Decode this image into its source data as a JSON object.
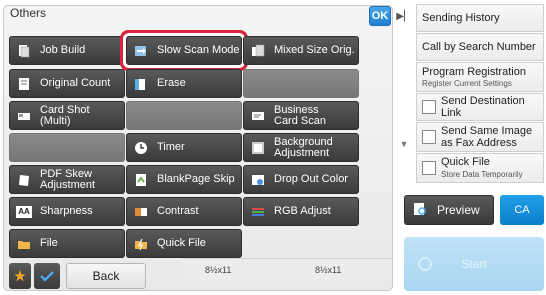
{
  "panel": {
    "title": "Others",
    "ok_label": "OK"
  },
  "grid": [
    {
      "label": "Job Build",
      "icon": "job-build-icon",
      "enabled": true
    },
    {
      "label": "Slow Scan Mode",
      "icon": "slow-scan-icon",
      "enabled": true,
      "highlighted": true
    },
    {
      "label": "Mixed Size Orig.",
      "icon": "mixed-size-icon",
      "enabled": true
    },
    {
      "label": "Original Count",
      "icon": "original-count-icon",
      "enabled": true
    },
    {
      "label": "Erase",
      "icon": "erase-icon",
      "enabled": true
    },
    {
      "label": "",
      "icon": "",
      "enabled": false
    },
    {
      "label": "Card Shot (Multi)",
      "icon": "card-shot-icon",
      "enabled": true
    },
    {
      "label": "",
      "icon": "",
      "enabled": false
    },
    {
      "label": "Business Card Scan",
      "icon": "business-card-icon",
      "enabled": true
    },
    {
      "label": "",
      "icon": "",
      "enabled": false
    },
    {
      "label": "Timer",
      "icon": "timer-icon",
      "enabled": true
    },
    {
      "label": "Background Adjustment",
      "icon": "background-icon",
      "enabled": true
    },
    {
      "label": "PDF Skew Adjustment",
      "icon": "pdf-skew-icon",
      "enabled": true
    },
    {
      "label": "BlankPage Skip",
      "icon": "blank-page-icon",
      "enabled": true
    },
    {
      "label": "Drop Out Color",
      "icon": "drop-out-icon",
      "enabled": true
    },
    {
      "label": "Sharpness",
      "icon": "sharpness-icon",
      "enabled": true
    },
    {
      "label": "Contrast",
      "icon": "contrast-icon",
      "enabled": true
    },
    {
      "label": "RGB Adjust",
      "icon": "rgb-adjust-icon",
      "enabled": true
    },
    {
      "label": "File",
      "icon": "folder-icon",
      "enabled": true
    },
    {
      "label": "Quick File",
      "icon": "quick-file-icon",
      "enabled": true
    }
  ],
  "bottom": {
    "back_label": "Back",
    "paper_left": "8½x11",
    "paper_right": "8½x11"
  },
  "right_menu": {
    "sending_history": "Sending History",
    "call_by_search": "Call by Search Number",
    "program_registration": "Program Registration",
    "program_registration_sub": "Register Current Settings",
    "send_destination_link": "Send Destination Link",
    "send_same_image": "Send Same Image as Fax Address",
    "quick_file": "Quick File",
    "quick_file_sub": "Store Data Temporarily"
  },
  "actions": {
    "preview_label": "Preview",
    "ca_label": "CA",
    "start_label": "Start"
  },
  "colors": {
    "accent": "#1f7fd0",
    "highlight_ring": "#d8243c",
    "button_dark": "#3a3a3a",
    "start_disabled": "#a9d6f1"
  }
}
